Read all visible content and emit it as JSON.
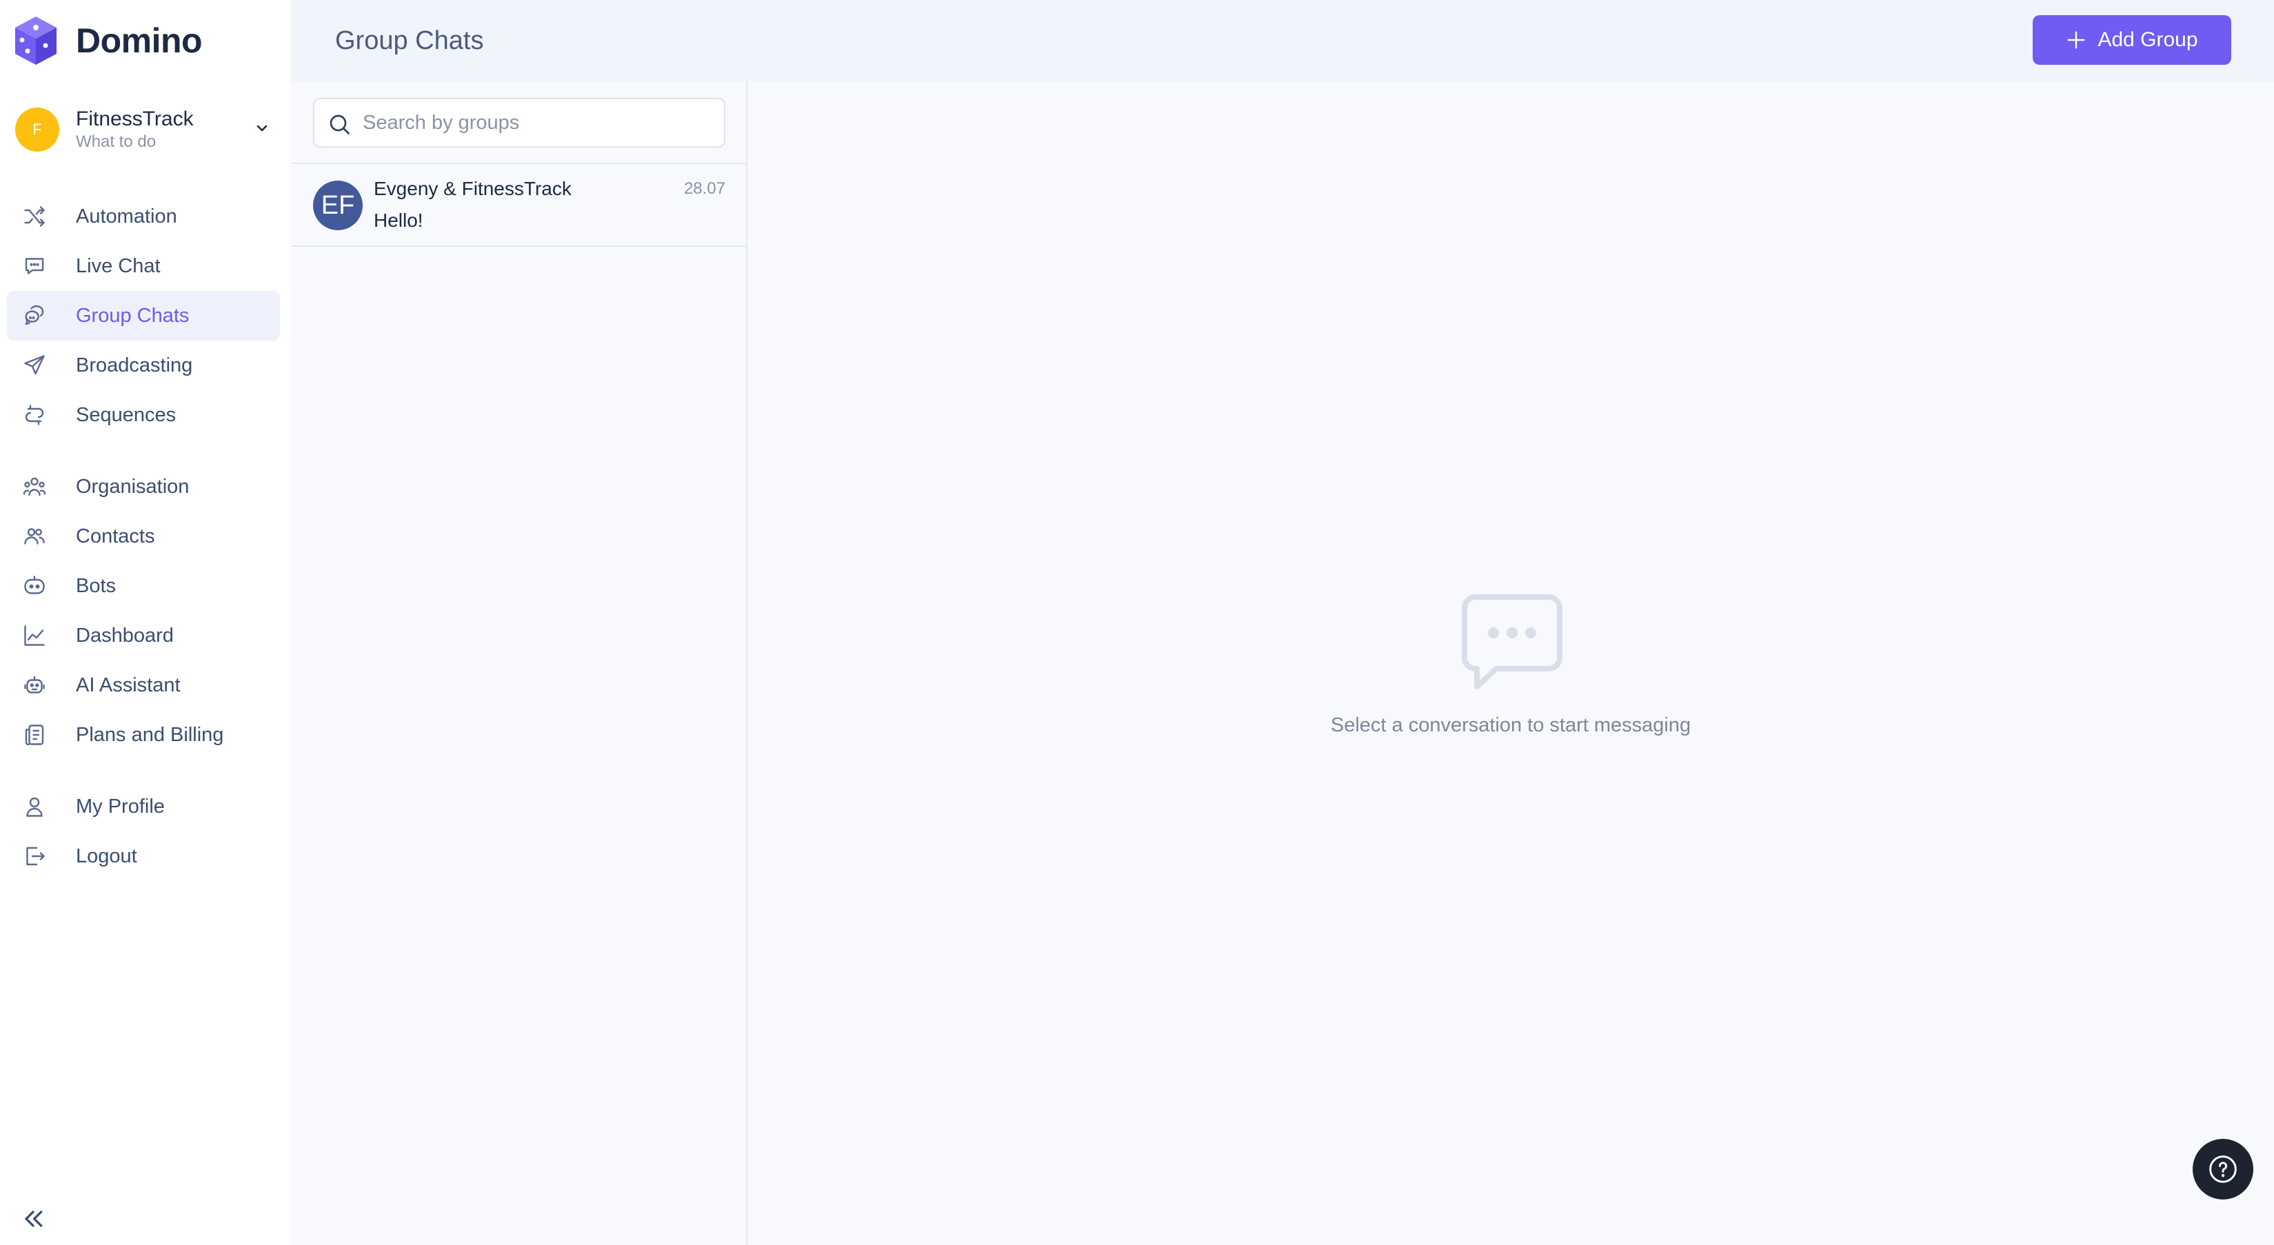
{
  "brand": {
    "name": "Domino",
    "logo_icon": "cube-logo-icon"
  },
  "workspace": {
    "initial": "F",
    "name": "FitnessTrack",
    "subtitle": "What to do"
  },
  "sidebar": {
    "items": [
      {
        "label": "Automation",
        "icon": "shuffle-icon"
      },
      {
        "label": "Live Chat",
        "icon": "chat-bubble-icon"
      },
      {
        "label": "Group Chats",
        "icon": "group-chat-icon",
        "active": true
      },
      {
        "label": "Broadcasting",
        "icon": "send-icon"
      },
      {
        "label": "Sequences",
        "icon": "sequence-icon"
      },
      {
        "label": "Organisation",
        "icon": "organisation-icon"
      },
      {
        "label": "Contacts",
        "icon": "contacts-icon"
      },
      {
        "label": "Bots",
        "icon": "bot-icon"
      },
      {
        "label": "Dashboard",
        "icon": "chart-line-icon"
      },
      {
        "label": "AI Assistant",
        "icon": "ai-robot-icon"
      },
      {
        "label": "Plans and Billing",
        "icon": "billing-icon"
      },
      {
        "label": "My Profile",
        "icon": "user-icon"
      },
      {
        "label": "Logout",
        "icon": "logout-icon"
      }
    ]
  },
  "header": {
    "title": "Group Chats",
    "add_button_label": "Add Group"
  },
  "search": {
    "placeholder": "Search by groups",
    "value": ""
  },
  "chats": [
    {
      "initials": "EF",
      "name": "Evgeny & FitnessTrack",
      "last_message": "Hello!",
      "date": "28.07"
    }
  ],
  "empty_state": {
    "text": "Select a conversation to start messaging"
  },
  "colors": {
    "accent": "#6f5cf2",
    "workspace_avatar": "#fdc011",
    "chat_avatar": "#43599a"
  }
}
